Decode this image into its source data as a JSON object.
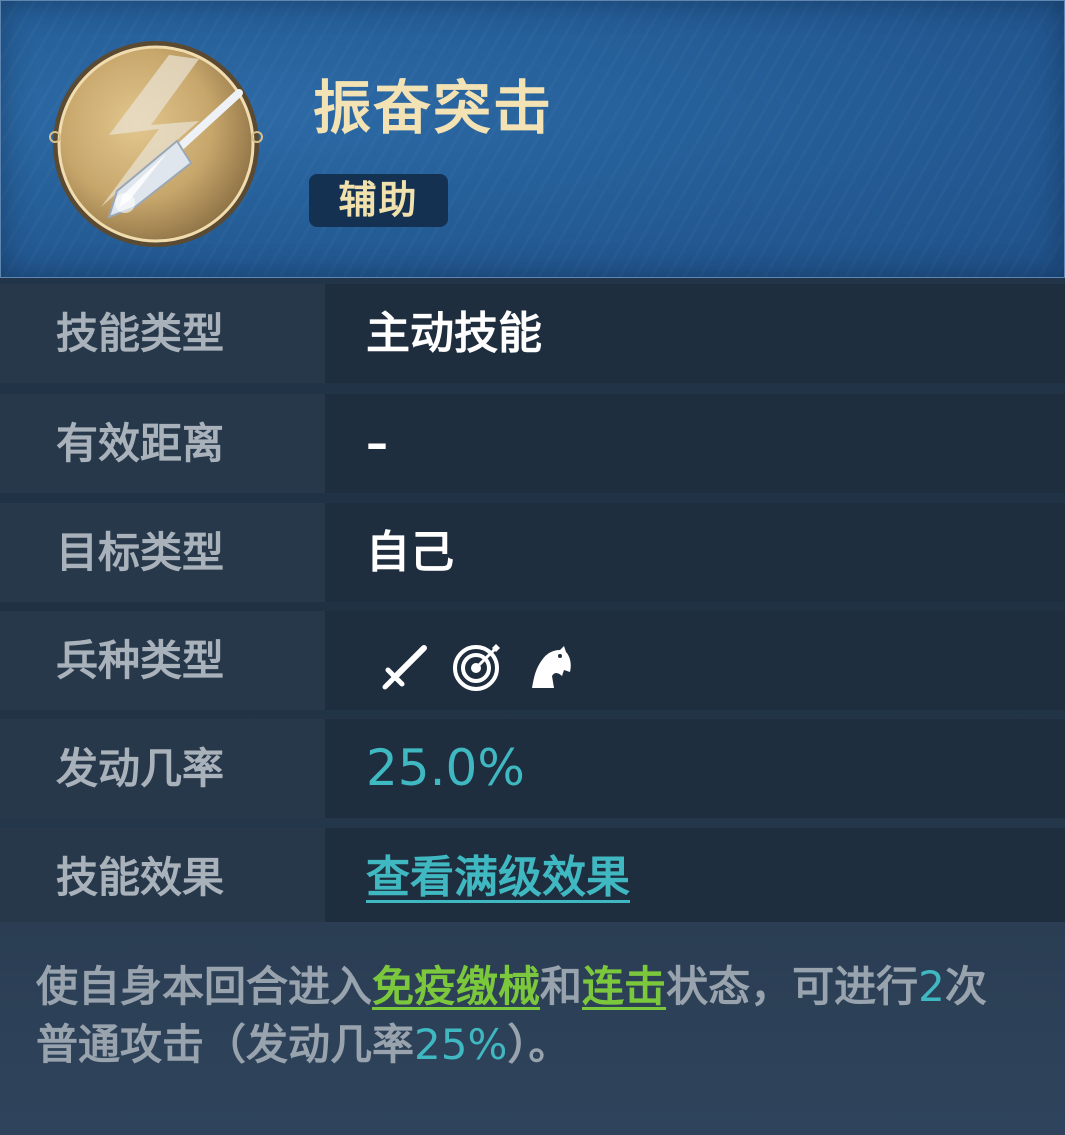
{
  "skill": {
    "name": "振奋突击",
    "tag": "辅助",
    "icon": "spear-lightning-icon"
  },
  "rows": [
    {
      "label": "技能类型",
      "value": "主动技能"
    },
    {
      "label": "有效距离",
      "value": "–"
    },
    {
      "label": "目标类型",
      "value": "自己"
    },
    {
      "label": "兵种类型",
      "icons": [
        "sword-icon",
        "target-icon",
        "horse-icon"
      ]
    },
    {
      "label": "发动几率",
      "value": "25.0%"
    },
    {
      "label": "技能效果",
      "value": "查看满级效果"
    }
  ],
  "description": {
    "part1": "使自身本回合进入",
    "kw1": "免疫缴械",
    "part2": "和",
    "kw2": "连击",
    "part3": "状态，可进行",
    "num": "2",
    "part4": "次普通攻击（发动几率",
    "rate": "25%",
    "part5": "）。"
  },
  "colors": {
    "title": "#f3e2b3",
    "accent_cyan": "#3fb8c2",
    "accent_green": "#7cc83c",
    "header_blue": "#26609a"
  }
}
